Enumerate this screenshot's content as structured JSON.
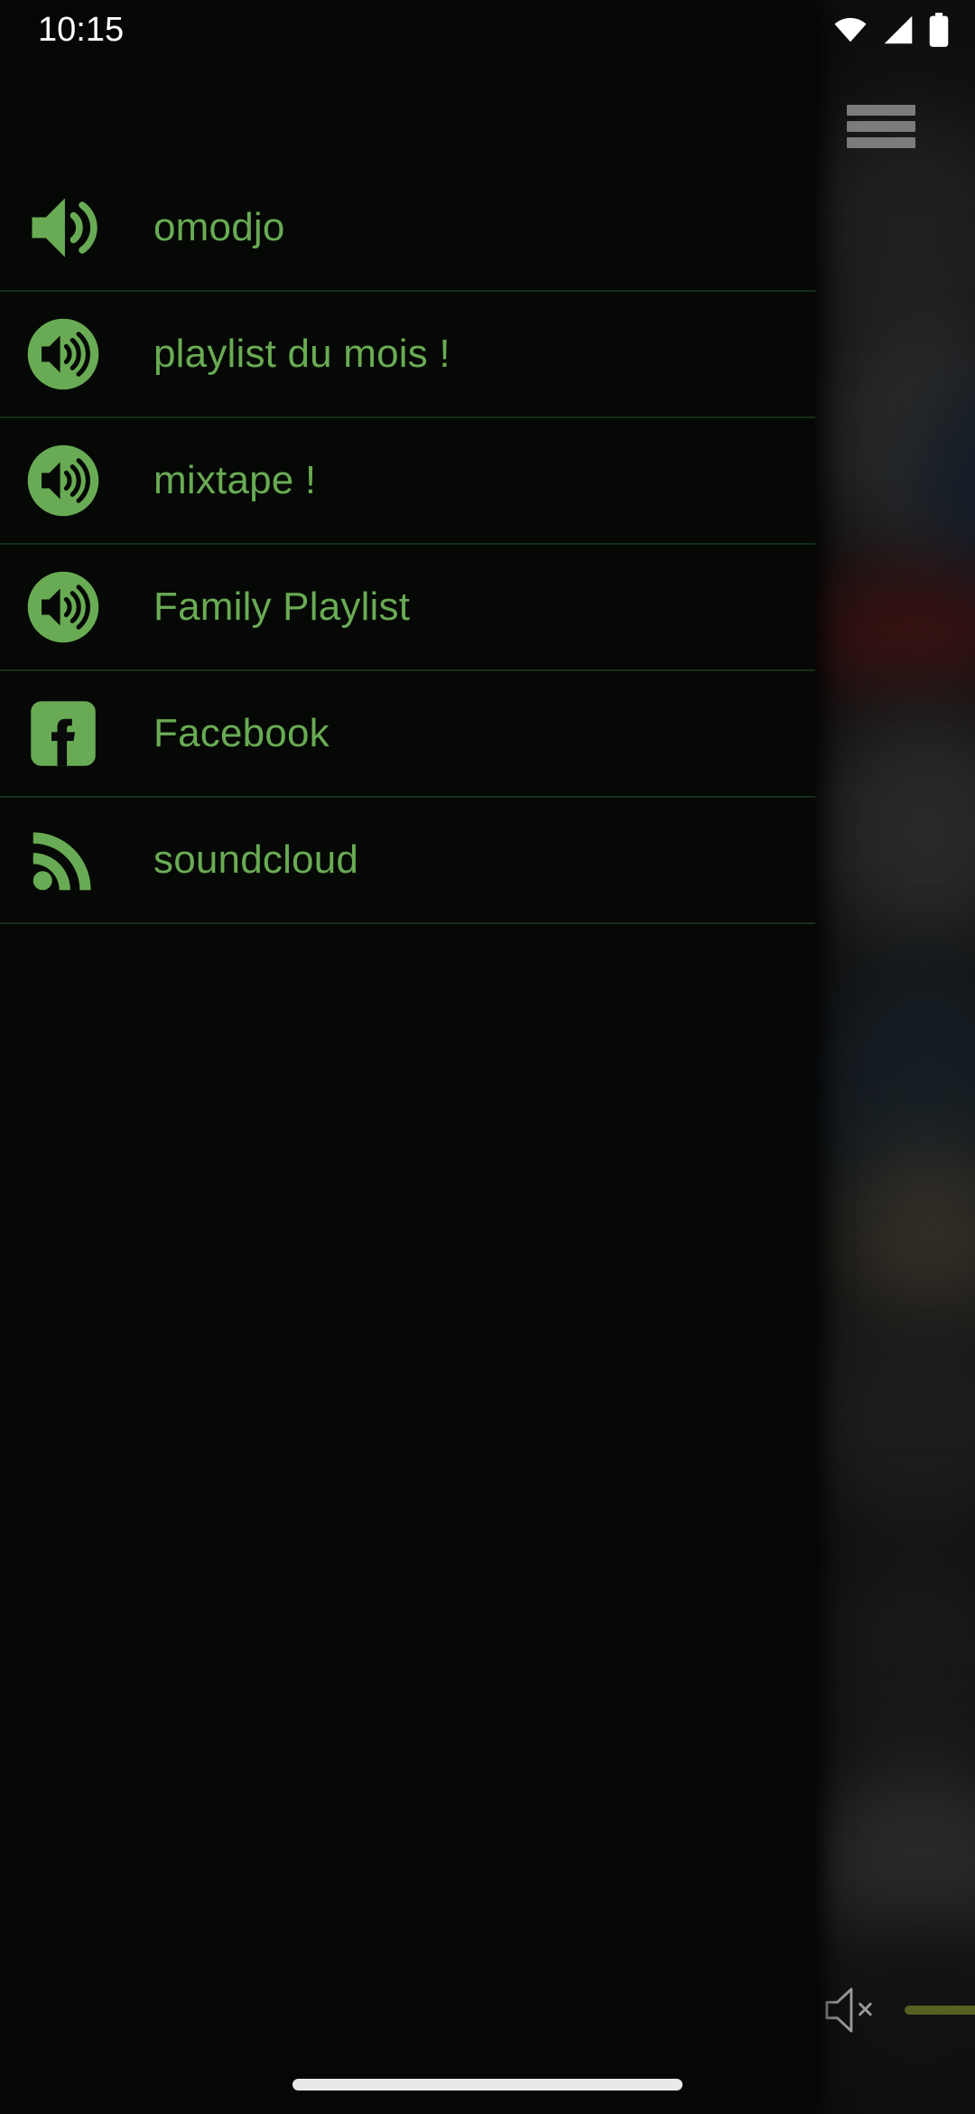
{
  "status_bar": {
    "time": "10:15",
    "icons": [
      "wifi-icon",
      "cellular-signal-icon",
      "battery-icon"
    ]
  },
  "theme": {
    "accent_green": "#69ab54",
    "drawer_background": "#050805",
    "divider": "#16301a",
    "slider_track": "#55611f",
    "status_text": "#ffffff",
    "hamburger_bar": "#7c7c7c"
  },
  "drawer": {
    "name": "navigation-drawer",
    "items": [
      {
        "label": "omodjo",
        "icon": "speaker-volume-icon"
      },
      {
        "label": "playlist du mois !",
        "icon": "speaker-circle-icon"
      },
      {
        "label": "mixtape !",
        "icon": "speaker-circle-icon"
      },
      {
        "label": "Family Playlist",
        "icon": "speaker-circle-icon"
      },
      {
        "label": "Facebook",
        "icon": "facebook-icon"
      },
      {
        "label": "soundcloud",
        "icon": "rss-feed-icon"
      }
    ]
  },
  "app": {
    "menu_button": "hamburger-menu-icon",
    "volume": {
      "mute_icon": "speaker-muted-icon",
      "slider": "volume-slider"
    }
  },
  "system_nav": {
    "gesture_pill": "gesture-navigation-pill"
  }
}
